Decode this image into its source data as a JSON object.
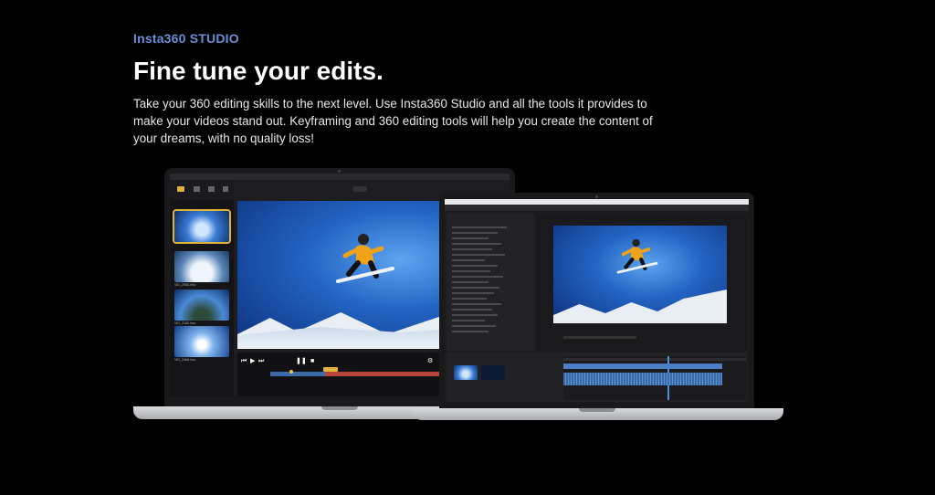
{
  "hero": {
    "eyebrow": "Insta360 STUDIO",
    "headline": "Fine tune your edits.",
    "description": "Take your 360 editing skills to the next level. Use Insta360 Studio and all the tools it provides to make your videos stand out. Keyframing and 360 editing tools will help you create the content of your dreams, with no quality loss!"
  },
  "colors": {
    "eyebrow": "#6b8fd6",
    "highlight": "#e0b43a",
    "timeline_track": "#b8463b",
    "timeline_played": "#3b6ba8"
  },
  "icons": [
    "play-icon",
    "pause-icon",
    "skip-back-icon",
    "skip-forward-icon",
    "settings-icon"
  ]
}
